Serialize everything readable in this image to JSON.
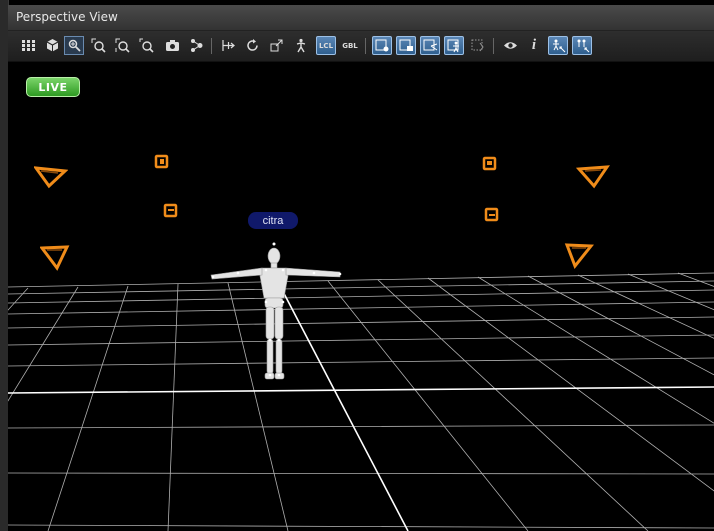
{
  "window": {
    "title": "Perspective View"
  },
  "viewport": {
    "live_badge": "LIVE",
    "actor_label": "citra"
  },
  "toolbar": {
    "lcl_label": "LCL",
    "gbl_label": "GBL"
  },
  "colors": {
    "camera": "#f08c1a",
    "grid": "#d8d8d8",
    "live_green": "#2e9a22",
    "label_bg": "#10196a"
  }
}
